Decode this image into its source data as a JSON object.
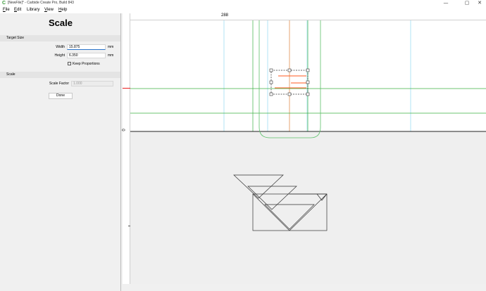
{
  "window": {
    "title": "[NewFile]* - Carbide Create Pro, Build 843",
    "app_icon": "C",
    "controls": {
      "minimize": "—",
      "maximize": "▢",
      "close": "✕"
    }
  },
  "menu": {
    "items": [
      {
        "key": "F",
        "rest": "ile"
      },
      {
        "key": "E",
        "rest": "dit"
      },
      {
        "key": "",
        "rest": "Library"
      },
      {
        "key": "V",
        "rest": "iew"
      },
      {
        "key": "H",
        "rest": "elp"
      }
    ]
  },
  "panel": {
    "title": "Scale",
    "target_size": {
      "heading": "Target Size",
      "width_label": "Width",
      "width_value": "15.875",
      "width_unit": "mm",
      "height_label": "Height",
      "height_value": "6.350",
      "height_unit": "mm",
      "keep_proportions_label": "Keep Proportions",
      "keep_proportions_checked": false
    },
    "scale": {
      "heading": "Scale",
      "factor_label": "Scale Factor",
      "factor_value": "1.000"
    },
    "done_label": "Done"
  },
  "canvas": {
    "ruler_top_label": "288",
    "ruler_left_label": "0",
    "colors": {
      "selection_orange": "#ff5a1f",
      "guide_green": "#3cb043",
      "guide_cyan": "#7fd4f0",
      "origin_red": "#e81c1c",
      "outline": "#333333"
    }
  }
}
